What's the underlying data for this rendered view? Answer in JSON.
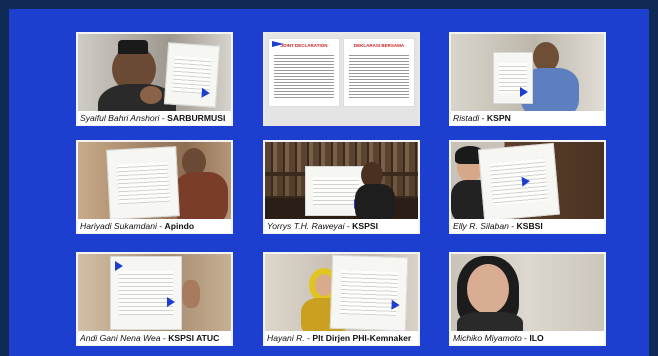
{
  "tiles": [
    {
      "name": "Syaiful Bahri Anshori",
      "sep": " - ",
      "org": "SARBURMUSI"
    },
    {
      "name": "",
      "sep": "",
      "org": ""
    },
    {
      "name": "Ristadi",
      "sep": " - ",
      "org": "KSPN"
    },
    {
      "name": "Hariyadi Sukamdani",
      "sep": " - ",
      "org": "Apindo"
    },
    {
      "name": "Yorrys T.H. Raweyai",
      "sep": " - ",
      "org": "KSPSI"
    },
    {
      "name": "Elly R. Silaban",
      "sep": " - ",
      "org": "KSBSI"
    },
    {
      "name": "Andi Gani Nena Wea",
      "sep": " - ",
      "org": "KSPSI ATUC"
    },
    {
      "name": "Hayani R.",
      "sep": " - ",
      "org": "Plt Dirjen PHI-Kemnaker"
    },
    {
      "name": "Michiko Miyamoto",
      "sep": " - ",
      "org": "ILO"
    }
  ],
  "document": {
    "left_title": "JOINT DECLARATION",
    "right_title": "DEKLARASI BERSAMA"
  },
  "colors": {
    "background": "#1d3fd0",
    "frame": "#0f2a55",
    "accent_triangle": "#1d3fd0"
  }
}
